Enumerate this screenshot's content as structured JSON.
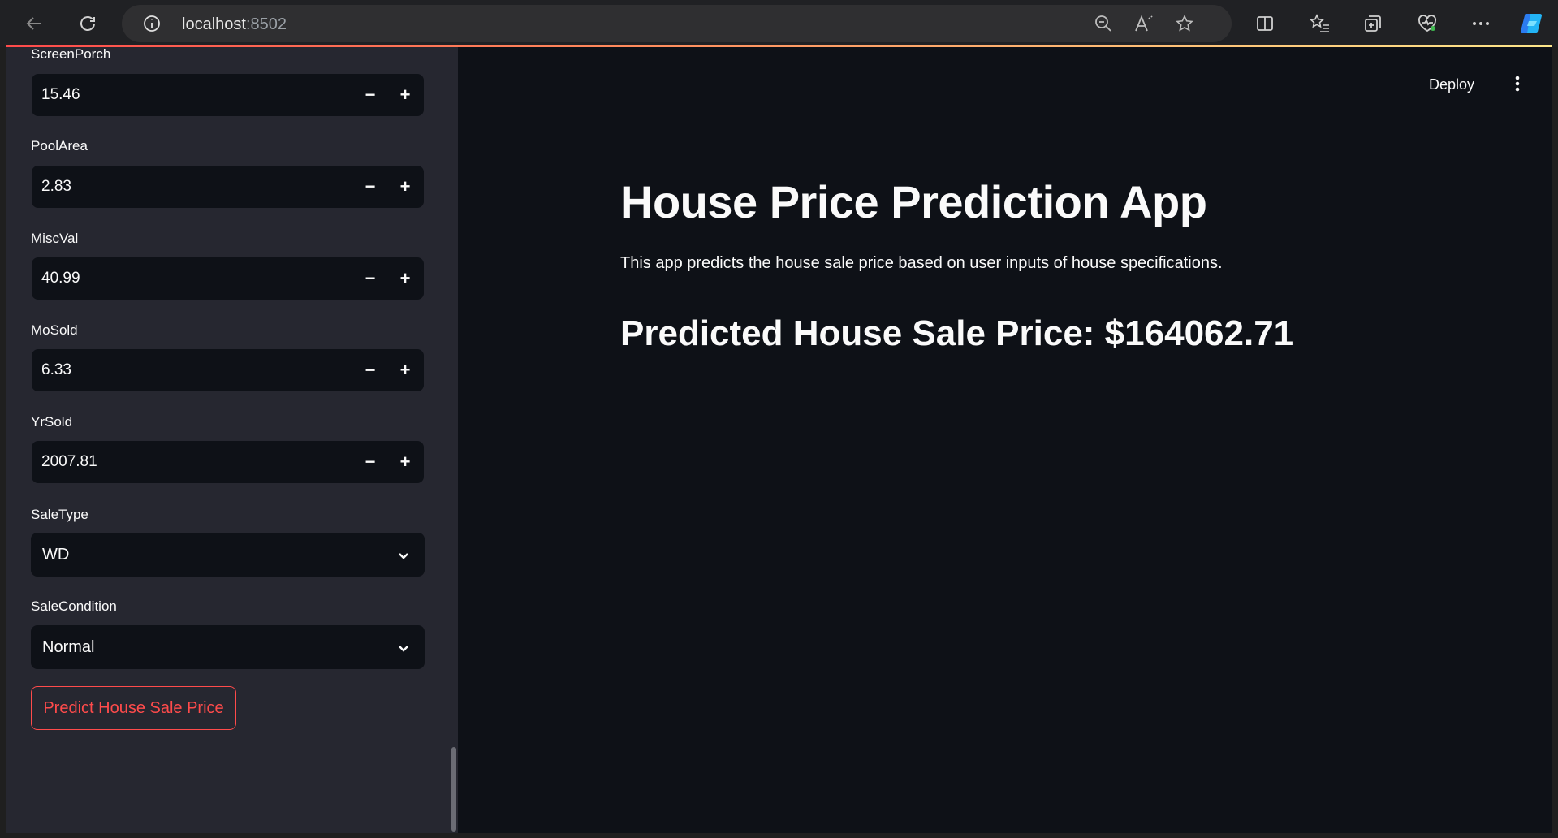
{
  "browser": {
    "url_host": "localhost",
    "url_port": ":8502"
  },
  "sidebar": {
    "number_inputs": [
      {
        "label": "ScreenPorch",
        "value": "15.46"
      },
      {
        "label": "PoolArea",
        "value": "2.83"
      },
      {
        "label": "MiscVal",
        "value": "40.99"
      },
      {
        "label": "MoSold",
        "value": "6.33"
      },
      {
        "label": "YrSold",
        "value": "2007.81"
      }
    ],
    "selects": [
      {
        "label": "SaleType",
        "value": "WD"
      },
      {
        "label": "SaleCondition",
        "value": "Normal"
      }
    ],
    "step_minus": "−",
    "step_plus": "+",
    "predict_button": "Predict House Sale Price"
  },
  "header": {
    "deploy_label": "Deploy"
  },
  "main": {
    "title": "House Price Prediction App",
    "description": "This app predicts the house sale price based on user inputs of house specifications.",
    "result": "Predicted House Sale Price: $164062.71"
  },
  "colors": {
    "accent": "#ff4b4b",
    "app_background": "#0e1117",
    "sidebar_background": "#262730"
  }
}
